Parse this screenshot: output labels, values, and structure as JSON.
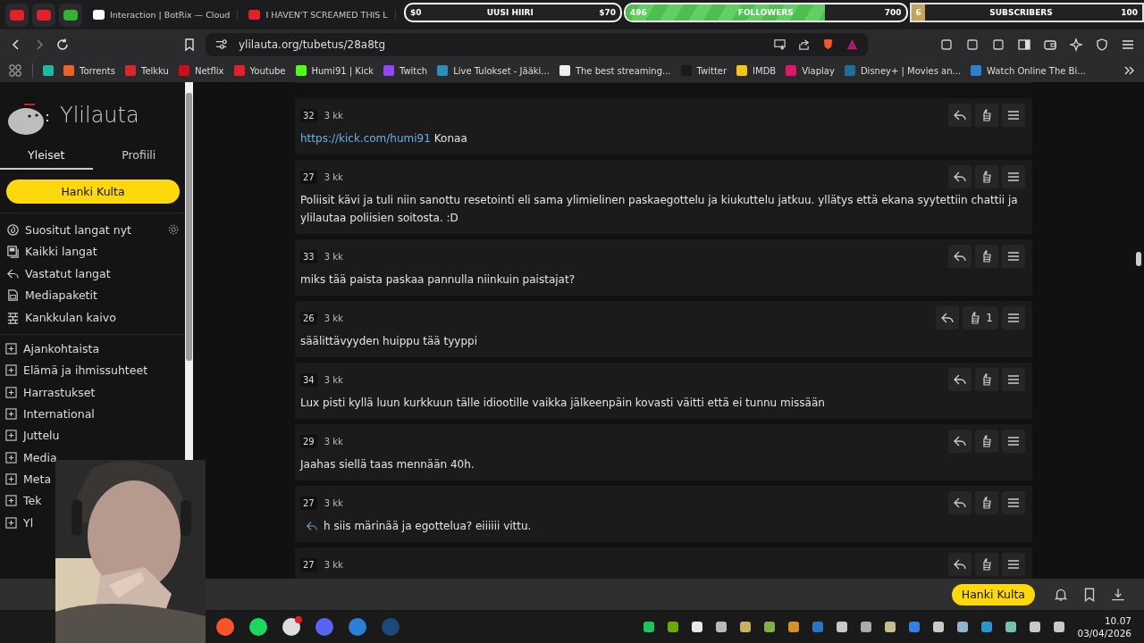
{
  "tabs": [
    {
      "kind": "pinned",
      "color": "#e5202a"
    },
    {
      "kind": "pinned",
      "color": "#e5202a"
    },
    {
      "kind": "pinned",
      "color": "#34b233"
    },
    {
      "kind": "titled",
      "color": "#ffffff",
      "title": "Interaction | BotRix — Cloud"
    },
    {
      "kind": "titled",
      "color": "#e5202a",
      "title": "I HAVEN'T SCREAMED THIS L"
    }
  ],
  "stream_overlays": [
    {
      "kind": "goal",
      "start": "$0",
      "label": "UUSI HIIRI",
      "end": "$70"
    },
    {
      "kind": "followers",
      "start": "496",
      "label": "FOLLOWERS",
      "end": "700",
      "level": 0.71
    },
    {
      "kind": "subscribers",
      "start": "6",
      "label": "SUBSCRIBERS",
      "end": "100",
      "level": 0.06
    }
  ],
  "address": "ylilauta.org/tubetus/28a8tg",
  "bookmarks": [
    {
      "color": "#1db9a0"
    },
    {
      "label": "Torrents",
      "color": "#e8622c"
    },
    {
      "label": "Telkku",
      "color": "#d8282e"
    },
    {
      "label": "Netflix",
      "color": "#c8101a"
    },
    {
      "label": "Youtube",
      "color": "#e5202a"
    },
    {
      "label": "Humi91 | Kick",
      "color": "#53fc18"
    },
    {
      "label": "Twitch",
      "color": "#9146ff"
    },
    {
      "label": "Live Tulokset - Jääki...",
      "color": "#2a8fbf"
    },
    {
      "label": "The best streaming...",
      "color": "#eeeeee"
    },
    {
      "label": "Twitter",
      "color": "#1a1a1a"
    },
    {
      "label": "IMDB",
      "color": "#f5c518"
    },
    {
      "label": "Viaplay",
      "color": "#e2146c"
    },
    {
      "label": "Disney+ | Movies an...",
      "color": "#1f6f9a"
    },
    {
      "label": "Watch Online The Bi...",
      "color": "#2f7fd0"
    }
  ],
  "sidebar": {
    "site_name": "Ylilauta",
    "tabs": [
      {
        "label": "Yleiset",
        "selected": true
      },
      {
        "label": "Profiili",
        "selected": false
      }
    ],
    "gold_button": "Hanki Kulta",
    "nav_items": [
      {
        "kind": "popular",
        "label": "Suositut langat nyt"
      },
      {
        "kind": "all",
        "label": "Kaikki langat"
      },
      {
        "kind": "replied",
        "label": "Vastatut langat"
      },
      {
        "kind": "media",
        "label": "Mediapaketit"
      },
      {
        "kind": "well",
        "label": "Kankkulan kaivo"
      }
    ],
    "categories": [
      "Ajankohtaista",
      "Elämä ja ihmissuhteet",
      "Harrastukset",
      "International",
      "Juttelu",
      "Media",
      "Meta",
      "Tek",
      "Yl"
    ]
  },
  "posts": [
    {
      "number": "32",
      "age": "3 kk",
      "reply_link": false,
      "link": "https://kick.com/humi91",
      "text": "Konaa"
    },
    {
      "number": "27",
      "age": "3 kk",
      "reply_link": false,
      "text": "Poliisit kävi ja tuli niin sanottu resetointi eli sama ylimielinen paskaegottelu ja kiukuttelu jatkuu. yllätys että ekana syytettiin chattii ja ylilautaa poliisien soitosta. :D"
    },
    {
      "number": "33",
      "age": "3 kk",
      "reply_link": false,
      "text": "miks tää paista paskaa pannulla niinkuin paistajat?"
    },
    {
      "number": "26",
      "age": "3 kk",
      "reply_link": false,
      "reactions": "1",
      "text": "säälittävyyden huippu tää tyyppi"
    },
    {
      "number": "34",
      "age": "3 kk",
      "reply_link": false,
      "text": "Lux pisti kyllä luun kurkkuun tälle idiootille vaikka jälkeenpäin kovasti väitti että ei tunnu missään"
    },
    {
      "number": "29",
      "age": "3 kk",
      "reply_link": false,
      "text": "Jaahas siellä taas mennään 40h."
    },
    {
      "number": "27",
      "age": "3 kk",
      "reply_link": true,
      "text": "h siis märinää ja egottelua? eiiiiii vittu."
    },
    {
      "number": "27",
      "age": "3 kk"
    }
  ],
  "bottom_bar": {
    "gold_button": "Hanki Kulta"
  },
  "taskbar": {
    "apps": [
      {
        "color": "#fb542b",
        "notification": false
      },
      {
        "color": "#1ed760",
        "notification": false
      },
      {
        "color": "#dddddd",
        "notification": true
      },
      {
        "color": "#5865f2",
        "notification": false
      },
      {
        "color": "#2d7fd8",
        "notification": false
      },
      {
        "color": "#1b4a7a",
        "notification": false
      }
    ],
    "time": "10.07",
    "date": "03/04/2026"
  }
}
